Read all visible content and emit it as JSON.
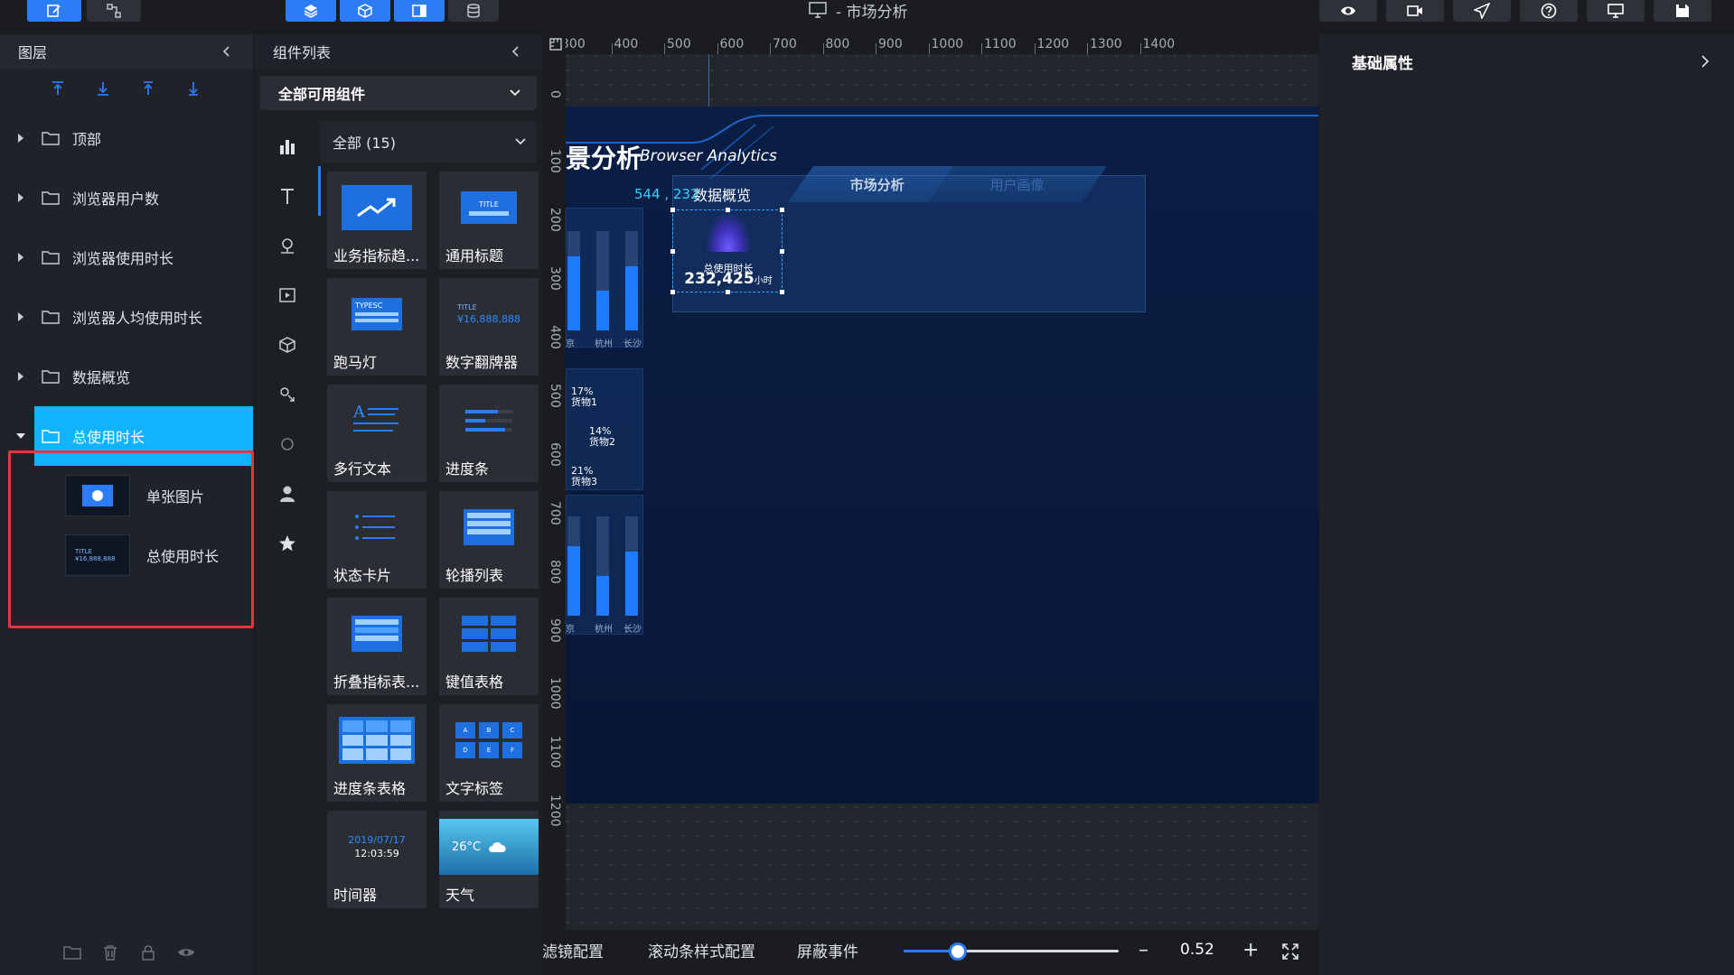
{
  "app": {
    "doc_title": "- 市场分析"
  },
  "toolbar": {
    "left": [
      {
        "icon": "edit-icon",
        "active": true
      },
      {
        "icon": "share-node-icon",
        "active": false
      }
    ],
    "center": [
      {
        "icon": "layers-icon",
        "active": true
      },
      {
        "icon": "cube-icon",
        "active": true
      },
      {
        "icon": "panel-icon",
        "active": true
      },
      {
        "icon": "database-icon",
        "active": false
      }
    ],
    "right": [
      "eye-icon",
      "video-icon",
      "send-icon",
      "help-icon",
      "monitor-icon",
      "save-icon"
    ]
  },
  "layers": {
    "title": "图层",
    "items": [
      {
        "label": "顶部",
        "expanded": false
      },
      {
        "label": "浏览器用户数",
        "expanded": false
      },
      {
        "label": "浏览器使用时长",
        "expanded": false
      },
      {
        "label": "浏览器人均使用时长",
        "expanded": false
      },
      {
        "label": "数据概览",
        "expanded": false
      },
      {
        "label": "总使用时长",
        "expanded": true,
        "selected": true
      }
    ],
    "children": [
      {
        "label": "单张图片",
        "thumb": "image-thumb-icon"
      },
      {
        "label": "总使用时长",
        "thumb": "number-thumb-icon"
      }
    ],
    "child_thumb_text": [
      "TITLE",
      "¥16,888,888"
    ]
  },
  "components": {
    "title": "组件列表",
    "dropdown": "全部可用组件",
    "filter": "全部 (15)",
    "categories": [
      "bar-chart-icon",
      "text-icon",
      "map-pin-icon",
      "media-icon",
      "cube-icon",
      "interaction-icon",
      "circle-icon",
      "user-icon",
      "star-icon"
    ],
    "cards": [
      {
        "label": "业务指标趋...",
        "preview": "trend"
      },
      {
        "label": "通用标题",
        "preview": "title"
      },
      {
        "label": "跑马灯",
        "preview": "marquee"
      },
      {
        "label": "数字翻牌器",
        "preview": "flip"
      },
      {
        "label": "多行文本",
        "preview": "multiline"
      },
      {
        "label": "进度条",
        "preview": "progress"
      },
      {
        "label": "状态卡片",
        "preview": "status"
      },
      {
        "label": "轮播列表",
        "preview": "carousel"
      },
      {
        "label": "折叠指标表...",
        "preview": "fold"
      },
      {
        "label": "键值表格",
        "preview": "kv"
      },
      {
        "label": "进度条表格",
        "preview": "ptable"
      },
      {
        "label": "文字标签",
        "preview": "tags"
      },
      {
        "label": "时间器",
        "preview": "timer"
      },
      {
        "label": "天气",
        "preview": "weather"
      }
    ],
    "preview_text": {
      "title": "TITLE",
      "typesc": "TYPESC",
      "flip_title": "TITLE",
      "flip_value": "¥16,888,888",
      "timer_date": "2019/07/17",
      "timer_time": "12:03:59",
      "weather_temp": "26°C",
      "tags": [
        "A",
        "B",
        "C",
        "D",
        "E",
        "F"
      ]
    }
  },
  "canvas": {
    "ruler_x": [
      "300",
      "400",
      "500",
      "600",
      "700",
      "800",
      "900",
      "1000",
      "1100",
      "1200",
      "1300",
      "1400"
    ],
    "ruler_y": [
      "0",
      "100",
      "200",
      "300",
      "400",
      "500",
      "600",
      "700",
      "800",
      "900",
      "1000",
      "1100",
      "1200"
    ],
    "screen_title": "景分析",
    "screen_subtitle": "Browser Analytics",
    "tabs": [
      {
        "label": "市场分析",
        "active": true
      },
      {
        "label": "用户画像",
        "active": false
      }
    ],
    "coord_readout": "544 , 232",
    "overview_title": "数据概览",
    "selected_widget": {
      "label": "总使用时长",
      "value": "232,425",
      "unit": "小时"
    },
    "top_bars": {
      "labels": [
        "京",
        "杭州",
        "长沙"
      ],
      "fill": [
        0.75,
        0.4,
        0.65
      ]
    },
    "bottom_bars": {
      "labels": [
        "京",
        "杭州",
        "长沙"
      ],
      "fill": [
        0.7,
        0.4,
        0.65
      ]
    },
    "pie_labels": [
      {
        "pct": "17%",
        "name": "货物1"
      },
      {
        "pct": "14%",
        "name": "货物2"
      },
      {
        "pct": "21%",
        "name": "货物3"
      }
    ]
  },
  "props": {
    "title": "基础属性"
  },
  "bottombar": {
    "filter_config": "滤镜配置",
    "scroll_config": "滚动条样式配置",
    "mask_events": "屏蔽事件",
    "zoom_value": "0.52",
    "zoom_fraction": 0.25,
    "minus": "–",
    "plus": "+"
  }
}
